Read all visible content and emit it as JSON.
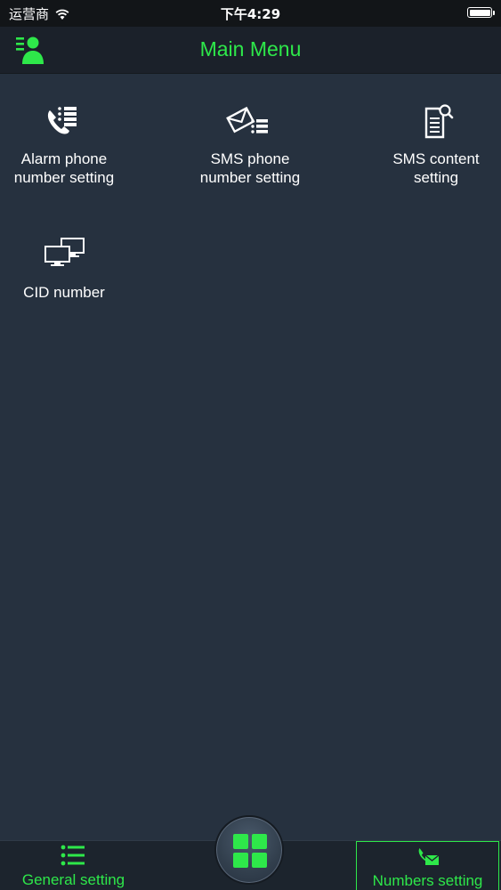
{
  "status_bar": {
    "carrier": "运营商",
    "time": "下午4:29",
    "battery_level": 1.0
  },
  "header": {
    "title": "Main Menu",
    "left_icon": "user-list-icon"
  },
  "menu": {
    "items": [
      {
        "label": "Alarm phone\nnumber setting",
        "icon": "phone-list-icon"
      },
      {
        "label": "SMS phone\nnumber setting",
        "icon": "envelope-list-icon"
      },
      {
        "label": "SMS content\nsetting",
        "icon": "document-search-icon"
      },
      {
        "label": "CID number",
        "icon": "monitors-icon"
      }
    ]
  },
  "tab_bar": {
    "general": {
      "label": "General setting",
      "icon": "list-icon"
    },
    "home": {
      "icon": "grid-icon"
    },
    "numbers": {
      "label": "Numbers setting",
      "icon": "phone-message-icon",
      "selected": true
    }
  },
  "colors": {
    "accent": "#2ee84a",
    "background": "#26313f",
    "nav_bar": "#1b212a",
    "status_bar": "#121518",
    "text": "#ffffff"
  }
}
